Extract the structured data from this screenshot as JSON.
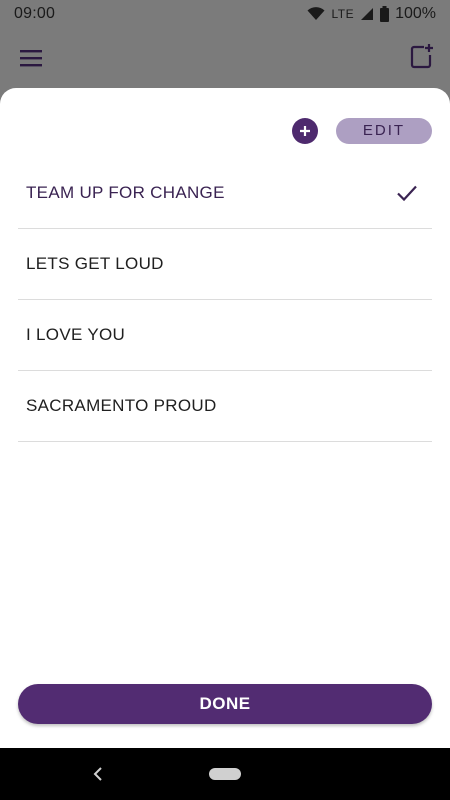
{
  "status_bar": {
    "time": "09:00",
    "network": "LTE",
    "battery": "100%",
    "icons": [
      "wifi-icon",
      "signal-icon",
      "battery-icon"
    ]
  },
  "app_bar": {
    "icons": [
      "menu-icon",
      "compose-icon"
    ]
  },
  "sheet": {
    "edit_label": "EDIT",
    "add_icon": "plus-icon",
    "items": [
      {
        "label": "TEAM UP FOR CHANGE",
        "selected": true
      },
      {
        "label": "LETS GET LOUD",
        "selected": false
      },
      {
        "label": "I LOVE YOU",
        "selected": false
      },
      {
        "label": "SACRAMENTO PROUD",
        "selected": false
      }
    ],
    "done_label": "DONE"
  },
  "nav_bar": {
    "icons": [
      "back-icon",
      "home-icon"
    ]
  },
  "colors": {
    "accent": "#522c72",
    "edit_bg": "#ad9fc2",
    "scrim": "#7b7b7b"
  }
}
